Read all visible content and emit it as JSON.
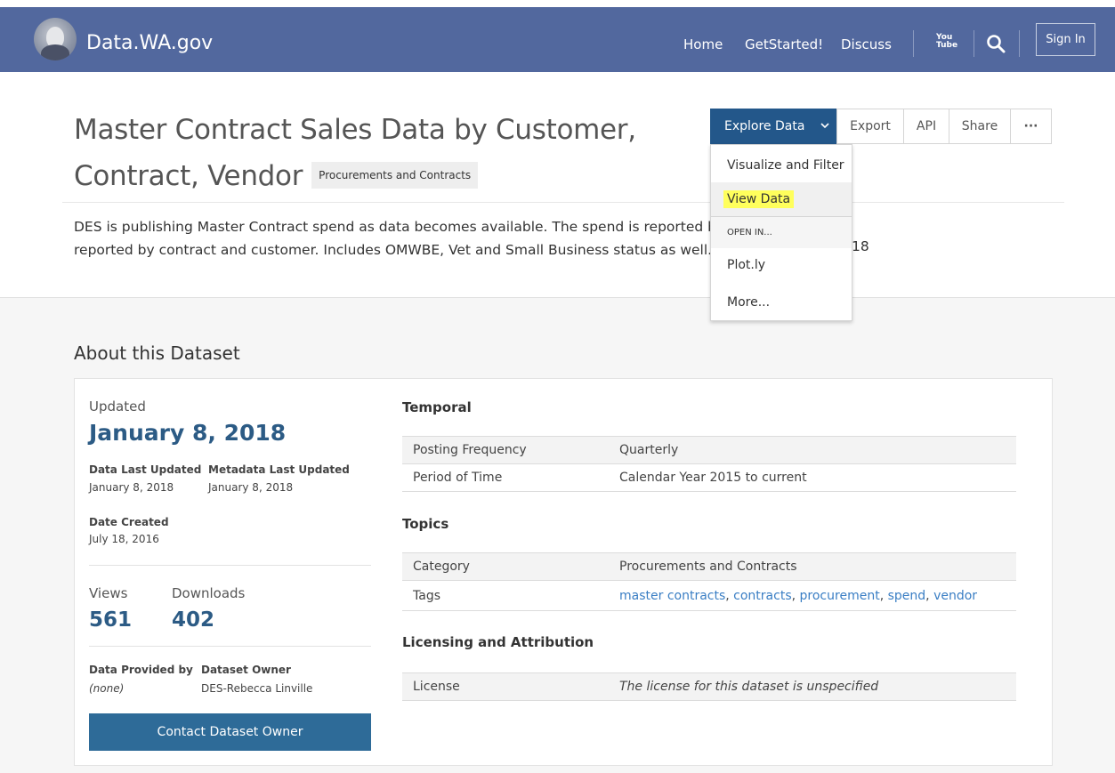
{
  "header": {
    "site_name": "Data.WA.gov",
    "nav": [
      "Home",
      "GetStarted!",
      "Discuss"
    ],
    "youtube_glyph": "You\nTube",
    "sign_in": "Sign In",
    "bg_color": "#52689e"
  },
  "dataset": {
    "title": "Master Contract Sales Data by Customer, Contract, Vendor",
    "category": "Procurements and Contracts",
    "description": "DES is publishing Master Contract spend as data becomes available. The spend is reported by vendors and is reported by contract and customer. Includes OMWBE, Vet and Small Business status as well.",
    "description_clipped_suffix": "18"
  },
  "toolbar": {
    "explore": "Explore Data",
    "export": "Export",
    "api": "API",
    "share": "Share",
    "more": "···"
  },
  "dropdown": {
    "items": [
      "Visualize and Filter",
      "View Data"
    ],
    "open_in_header": "OPEN IN...",
    "open_in_items": [
      "Plot.ly",
      "More..."
    ]
  },
  "about": {
    "section_title": "About this Dataset",
    "updated_label": "Updated",
    "updated_date": "January 8, 2018",
    "data_last_updated_label": "Data Last Updated",
    "data_last_updated": "January 8, 2018",
    "metadata_last_updated_label": "Metadata Last Updated",
    "metadata_last_updated": "January 8, 2018",
    "date_created_label": "Date Created",
    "date_created": "July 18, 2016",
    "views_label": "Views",
    "views": "561",
    "downloads_label": "Downloads",
    "downloads": "402",
    "data_provided_by_label": "Data Provided by",
    "data_provided_by": "(none)",
    "dataset_owner_label": "Dataset Owner",
    "dataset_owner": "DES-Rebecca Linville",
    "contact_button": "Contact Dataset Owner"
  },
  "temporal": {
    "heading": "Temporal",
    "rows": [
      {
        "k": "Posting Frequency",
        "v": "Quarterly"
      },
      {
        "k": "Period of Time",
        "v": "Calendar Year 2015 to current"
      }
    ]
  },
  "topics": {
    "heading": "Topics",
    "category_label": "Category",
    "category_value": "Procurements and Contracts",
    "tags_label": "Tags",
    "tags": [
      "master contracts",
      "contracts",
      "procurement",
      "spend",
      "vendor"
    ]
  },
  "licensing": {
    "heading": "Licensing and Attribution",
    "license_label": "License",
    "license_value": "The license for this dataset is unspecified"
  }
}
